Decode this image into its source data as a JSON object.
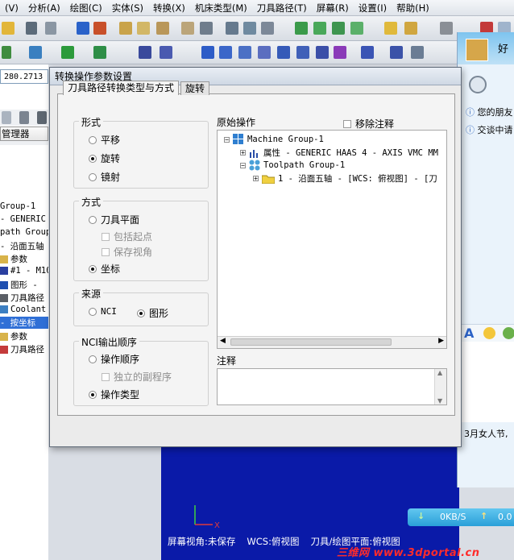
{
  "menubar": {
    "items": [
      "(V)",
      "分析(A)",
      "绘图(C)",
      "实体(S)",
      "转换(X)",
      "机床类型(M)",
      "刀具路径(T)",
      "屏幕(R)",
      "设置(I)",
      "帮助(H)"
    ]
  },
  "left_panel": {
    "coordinate_value": "280.2713",
    "manager_tab_label": "管理器",
    "tree_items": [
      "Group-1",
      " - GENERIC",
      "path Group",
      " - 沿面五轴",
      "参数",
      "#1 - M10",
      "图形 -",
      "刀具路径",
      "Coolant",
      " - 按坐标",
      "参数",
      "刀具路径"
    ]
  },
  "dialog": {
    "title": "转换操作参数设置",
    "tabs": [
      "刀具路径转换类型与方式",
      "旋转"
    ],
    "type_group": {
      "title": "形式",
      "options": [
        "平移",
        "旋转",
        "镜射"
      ],
      "selected": "旋转"
    },
    "method_group": {
      "title": "方式",
      "option_tool_plane": "刀具平面",
      "check_include_start": "包括起点",
      "check_keep_view": "保存视角",
      "option_coordinate": "坐标",
      "selected": "坐标"
    },
    "source_group": {
      "title": "来源",
      "options": [
        "NCI",
        "图形"
      ],
      "selected": "图形"
    },
    "nci_group": {
      "title": "NCI输出顺序",
      "option_op_order": "操作顺序",
      "check_sub_program": "独立的副程序",
      "option_op_type": "操作类型",
      "selected": "操作类型"
    },
    "original_ops_label": "原始操作",
    "remove_comment_label": "移除注释",
    "tree": {
      "machine_group": "Machine Group-1",
      "properties": "属性 - GENERIC HAAS 4 - AXIS VMC MM",
      "toolpath_group": "Toolpath Group-1",
      "operation": "1 - 沿面五轴 - [WCS: 俯视图] - [刀"
    },
    "comment_label": "注释"
  },
  "chat_panel": {
    "title_fragment": "好",
    "friend_text": "您的朋友",
    "chat_text": "交谈中请",
    "bottom_text": "3月女人节,",
    "net_speed_down": "0KB/S",
    "net_speed_up": "0.0"
  },
  "statusbar": {
    "screen_view": "屏幕视角:未保存",
    "wcs": "WCS:俯视图",
    "tool_plane": "刀具/绘图平面:俯视图"
  },
  "watermark": "三维网 www.3dportal.cn",
  "colors": {
    "viewport_blue": "#0a1aa8",
    "dialog_bg": "#ebebeb",
    "watermark_red": "#ff2b2b",
    "netbar_blue": "#2a9fd8"
  }
}
